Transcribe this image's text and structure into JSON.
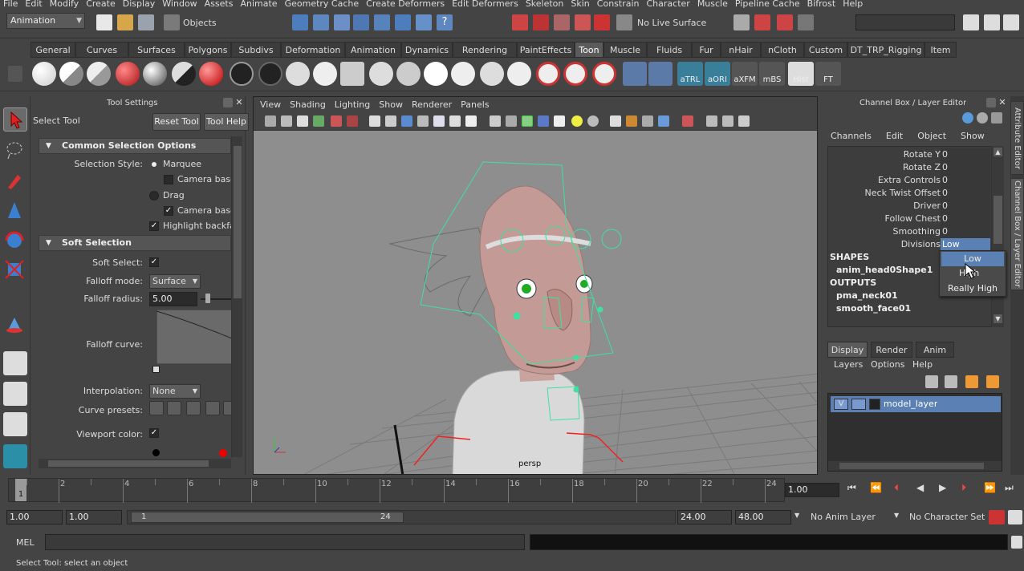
{
  "menubar": [
    "File",
    "Edit",
    "Modify",
    "Create",
    "Display",
    "Window",
    "Assets",
    "Animate",
    "Geometry Cache",
    "Create Deformers",
    "Edit Deformers",
    "Skeleton",
    "Skin",
    "Constrain",
    "Character",
    "Muscle",
    "Pipeline Cache",
    "Bifrost",
    "Help"
  ],
  "statusline": {
    "menuset": "Animation",
    "selection_mode": "Objects",
    "live_surface": "No Live Surface"
  },
  "shelf": {
    "tabs": [
      "General",
      "Curves",
      "Surfaces",
      "Polygons",
      "Subdivs",
      "Deformation",
      "Animation",
      "Dynamics",
      "Rendering",
      "PaintEffects",
      "Toon",
      "Muscle",
      "Fluids",
      "Fur",
      "nHair",
      "nCloth",
      "Custom",
      "DT_TRP_Rigging",
      "Item"
    ],
    "active_tab": "Toon",
    "captions": [
      "aTRL",
      "aORI",
      "aXFM",
      "mBS",
      "Hist",
      "FT"
    ]
  },
  "tool_settings": {
    "panel_title": "Tool Settings",
    "tool_name": "Select Tool",
    "reset_button": "Reset Tool",
    "help_button": "Tool Help",
    "common_header": "Common Selection Options",
    "selection_style_label": "Selection Style:",
    "marquee": "Marquee",
    "camera_based_1": "Camera based",
    "drag": "Drag",
    "camera_based_2": "Camera based",
    "highlight_backface": "Highlight backface",
    "soft_header": "Soft Selection",
    "soft_select_label": "Soft Select:",
    "falloff_mode_label": "Falloff mode:",
    "falloff_mode_value": "Surface",
    "falloff_radius_label": "Falloff radius:",
    "falloff_radius_value": "5.00",
    "falloff_curve_label": "Falloff curve:",
    "interpolation_label": "Interpolation:",
    "interpolation_value": "None",
    "curve_presets_label": "Curve presets:",
    "viewport_color_label": "Viewport color:"
  },
  "viewport": {
    "menu": [
      "View",
      "Shading",
      "Lighting",
      "Show",
      "Renderer",
      "Panels"
    ],
    "camera_label": "persp"
  },
  "channel_box": {
    "panel_title": "Channel Box / Layer Editor",
    "menu": [
      "Channels",
      "Edit",
      "Object",
      "Show"
    ],
    "rows": [
      {
        "name": "Rotate Y",
        "value": "0"
      },
      {
        "name": "Rotate Z",
        "value": "0"
      },
      {
        "name": "Extra Controls",
        "value": "0"
      },
      {
        "name": "Neck Twist Offset",
        "value": "0"
      },
      {
        "name": "Driver",
        "value": "0"
      },
      {
        "name": "Follow Chest",
        "value": "0"
      },
      {
        "name": "Smoothing",
        "value": "0"
      },
      {
        "name": "Divisions",
        "value": "Low"
      }
    ],
    "shapes_header": "SHAPES",
    "shape_item": "anim_head0Shape1",
    "outputs_header": "OUTPUTS",
    "outputs": [
      "pma_neck01",
      "smooth_face01"
    ],
    "popup_options": [
      "Low",
      "High",
      "Really High"
    ]
  },
  "layer_editor": {
    "tabs": [
      "Display",
      "Render",
      "Anim"
    ],
    "active_tab": "Display",
    "menu": [
      "Layers",
      "Options",
      "Help"
    ],
    "layer_visible": "V",
    "layer_name": "model_layer"
  },
  "side_tabs": [
    "Attribute Editor",
    "Channel Box / Layer Editor"
  ],
  "time_slider": {
    "ticks": [
      "2",
      "4",
      "6",
      "8",
      "10",
      "12",
      "14",
      "16",
      "18",
      "20",
      "22",
      "24"
    ],
    "current_frame_marker": "1",
    "current_time": "1.00"
  },
  "range_slider": {
    "start": "1.00",
    "playback_start": "1.00",
    "range_start_label": "1",
    "range_end_label": "24",
    "playback_end": "24.00",
    "end": "48.00",
    "anim_layer": "No Anim Layer",
    "character_set": "No Character Set"
  },
  "command_line": {
    "label": "MEL"
  },
  "help_line": "Select Tool: select an object"
}
